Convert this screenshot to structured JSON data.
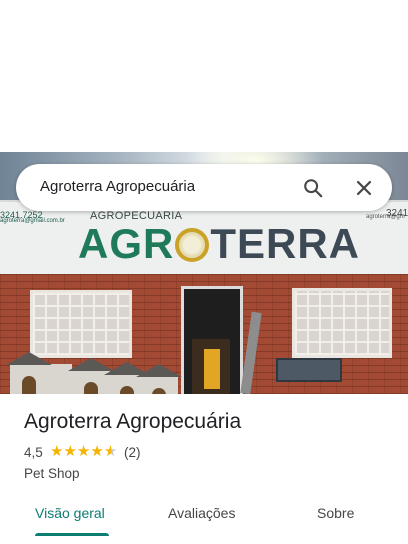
{
  "search": {
    "query": "Agroterra Agropecuária"
  },
  "photo": {
    "sign_sub": "AGROPECUÁRIA",
    "sign_big_1": "AGR",
    "sign_big_2": "TERRA",
    "phone_left": "3241.7252",
    "email_left": "agroterra@gmail.com.br",
    "phone_right": "3241",
    "email_right": "agroterra@gm"
  },
  "place": {
    "title": "Agroterra Agropecuária",
    "rating": "4,5",
    "stars": 4.5,
    "review_count": "(2)",
    "category": "Pet Shop"
  },
  "tabs": [
    {
      "label": "Visão geral",
      "active": true
    },
    {
      "label": "Avaliações",
      "active": false
    },
    {
      "label": "Sobre",
      "active": false
    }
  ],
  "colors": {
    "accent": "#0b7d71",
    "star": "#f4b400"
  }
}
